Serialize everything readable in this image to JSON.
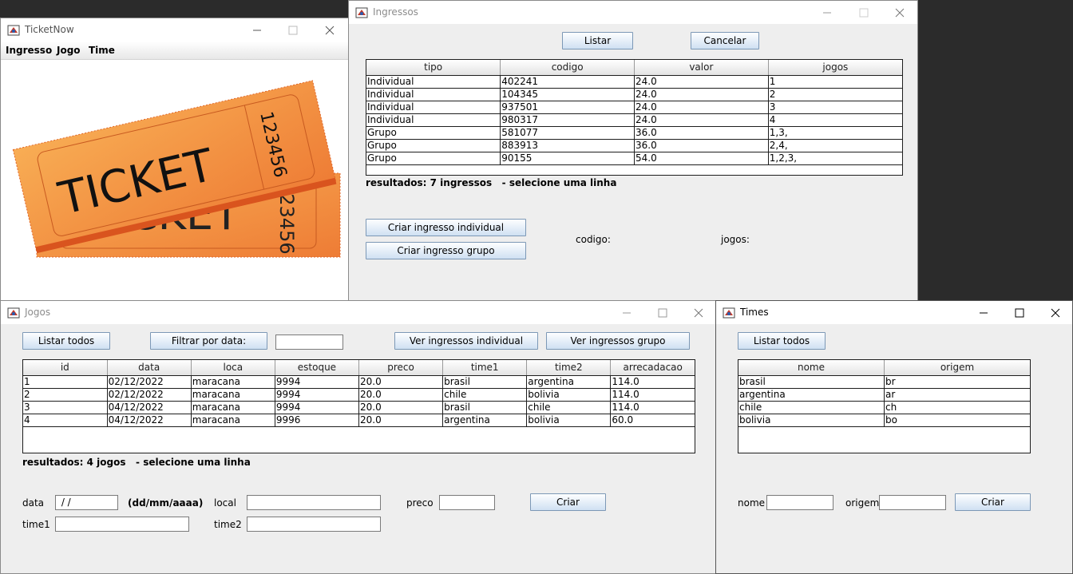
{
  "ticketnow": {
    "title": "TicketNow",
    "menu": [
      "Ingresso",
      "Jogo",
      "Time"
    ],
    "image": {
      "text_front": "TICKET",
      "number_front": "123456",
      "text_back": "TICKET",
      "number_back": "123456"
    }
  },
  "ingressos": {
    "title": "Ingressos",
    "listar_label": "Listar",
    "cancelar_label": "Cancelar",
    "columns": [
      "tipo",
      "codigo",
      "valor",
      "jogos"
    ],
    "rows": [
      [
        "Individual",
        "402241",
        "24.0",
        "1"
      ],
      [
        "Individual",
        "104345",
        "24.0",
        "2"
      ],
      [
        "Individual",
        "937501",
        "24.0",
        "3"
      ],
      [
        "Individual",
        "980317",
        "24.0",
        "4"
      ],
      [
        "Grupo",
        "581077",
        "36.0",
        "1,3,"
      ],
      [
        "Grupo",
        "883913",
        "36.0",
        "2,4,"
      ],
      [
        "Grupo",
        "90155",
        "54.0",
        "1,2,3,"
      ]
    ],
    "status": "resultados: 7 ingressos   - selecione uma linha",
    "criar_individual_label": "Criar ingresso individual",
    "criar_grupo_label": "Criar ingresso grupo",
    "codigo_label": "codigo:",
    "jogos_label": "jogos:"
  },
  "jogos": {
    "title": "Jogos",
    "listar_todos_label": "Listar todos",
    "filtrar_label": "Filtrar por data:",
    "filtrar_value": "",
    "ver_individual_label": "Ver ingressos individual",
    "ver_grupo_label": "Ver ingressos grupo",
    "columns": [
      "id",
      "data",
      "loca",
      "estoque",
      "preco",
      "time1",
      "time2",
      "arrecadacao"
    ],
    "rows": [
      [
        "1",
        "02/12/2022",
        "maracana",
        "9994",
        "20.0",
        "brasil",
        "argentina",
        "114.0"
      ],
      [
        "2",
        "02/12/2022",
        "maracana",
        "9994",
        "20.0",
        "chile",
        "bolivia",
        "114.0"
      ],
      [
        "3",
        "04/12/2022",
        "maracana",
        "9994",
        "20.0",
        "brasil",
        "chile",
        "114.0"
      ],
      [
        "4",
        "04/12/2022",
        "maracana",
        "9996",
        "20.0",
        "argentina",
        "bolivia",
        "60.0"
      ]
    ],
    "status": "resultados: 4 jogos   - selecione uma linha",
    "data_label": "data",
    "data_value": " / /",
    "date_format": "(dd/mm/aaaa)",
    "local_label": "local",
    "local_value": "",
    "preco_label": "preco",
    "preco_value": "",
    "criar_label": "Criar",
    "time1_label": "time1",
    "time1_value": "",
    "time2_label": "time2",
    "time2_value": ""
  },
  "times": {
    "title": "Times",
    "listar_todos_label": "Listar todos",
    "columns": [
      "nome",
      "origem"
    ],
    "rows": [
      [
        "brasil",
        "br"
      ],
      [
        "argentina",
        "ar"
      ],
      [
        "chile",
        "ch"
      ],
      [
        "bolivia",
        "bo"
      ]
    ],
    "nome_label": "nome",
    "nome_value": "",
    "origem_label": "origem",
    "origem_value": "",
    "criar_label": "Criar"
  },
  "colors": {
    "ticket_orange": "#f4923c",
    "ticket_dark": "#e0662a",
    "button_border": "#7c98b6"
  }
}
